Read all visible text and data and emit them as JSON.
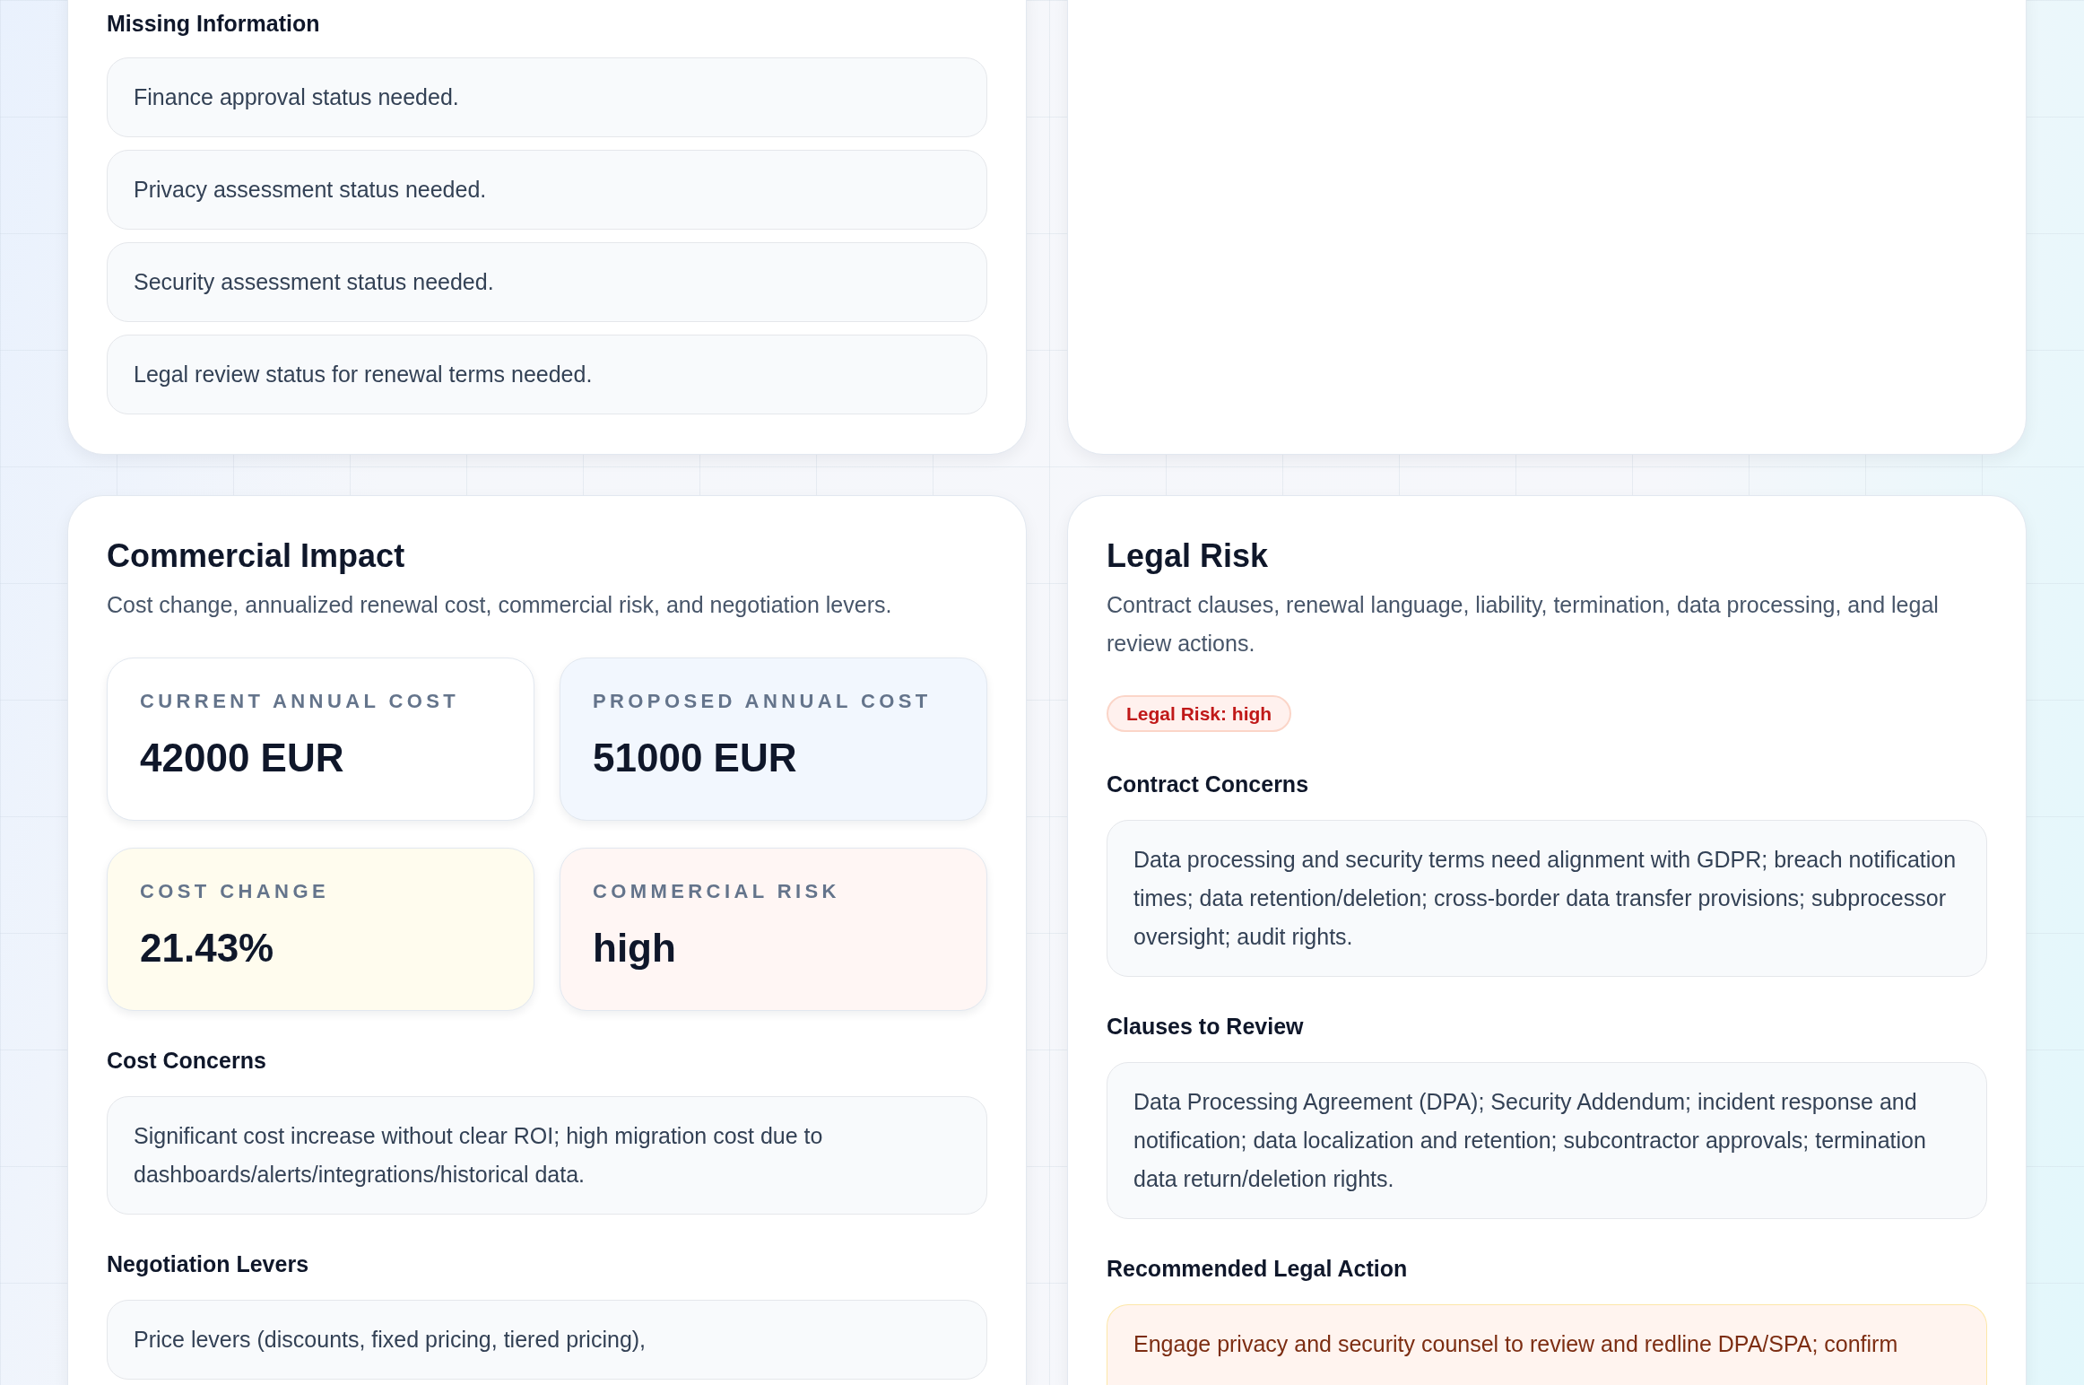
{
  "missing_information": {
    "title": "Missing Information",
    "items": [
      "Finance approval status needed.",
      "Privacy assessment status needed.",
      "Security assessment status needed.",
      "Legal review status for renewal terms needed."
    ]
  },
  "commercial_impact": {
    "title": "Commercial Impact",
    "subtitle": "Cost change, annualized renewal cost, commercial risk, and negotiation levers.",
    "metrics": [
      {
        "label": "CURRENT ANNUAL COST",
        "value": "42000 EUR",
        "color": "#ffffff"
      },
      {
        "label": "PROPOSED ANNUAL COST",
        "value": "51000 EUR",
        "color": "#f2f7fe"
      },
      {
        "label": "COST CHANGE",
        "value": "21.43%",
        "color": "#fffcee"
      },
      {
        "label": "COMMERCIAL RISK",
        "value": "high",
        "color": "#fff6f4"
      }
    ],
    "sections": [
      {
        "heading": "Cost Concerns",
        "text": "Significant cost increase without clear ROI; high migration cost due to dashboards/alerts/integrations/historical data.",
        "color": "#f8fafc"
      },
      {
        "heading": "Negotiation Levers",
        "text": "Price levers (discounts, fixed pricing, tiered pricing),",
        "color": "#f8fafc"
      }
    ]
  },
  "legal_risk": {
    "title": "Legal Risk",
    "subtitle": "Contract clauses, renewal language, liability, termination, data processing, and legal review actions.",
    "badge": {
      "text": "Legal Risk: high",
      "color": "#c01818"
    },
    "sections": [
      {
        "heading": "Contract Concerns",
        "text": "Data processing and security terms need alignment with GDPR; breach notification times; data retention/deletion; cross-border data transfer provisions; subprocessor oversight; audit rights.",
        "color": "#f8fafc"
      },
      {
        "heading": "Clauses to Review",
        "text": "Data Processing Agreement (DPA); Security Addendum; incident response and notification; data localization and retention; subcontractor approvals; termination data return/deletion rights.",
        "color": "#f8fafc"
      },
      {
        "heading": "Recommended Legal Action",
        "text": "Engage privacy and security counsel to review and redline DPA/SPA; confirm",
        "color": "#fff4ef"
      }
    ]
  }
}
